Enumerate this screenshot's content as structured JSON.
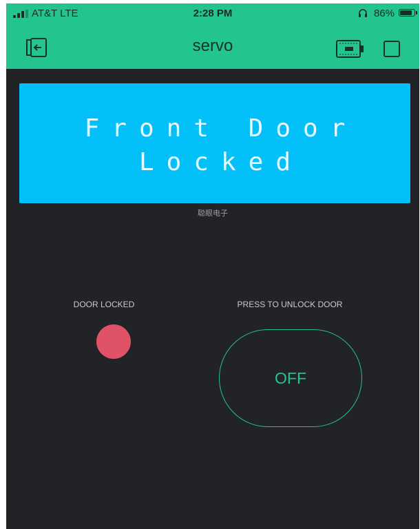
{
  "status_bar": {
    "carrier": "AT&T  LTE",
    "time": "2:28 PM",
    "battery": "86%",
    "battery_level": 0.86
  },
  "nav": {
    "title": "servo",
    "back_icon": "exit-icon",
    "device_icon": "device-icon",
    "stop_icon": "square-icon"
  },
  "lcd": {
    "line1": "Front Door",
    "line2": "Locked",
    "caption": "聪眼电子"
  },
  "led": {
    "label": "DOOR LOCKED",
    "color": "#e05268"
  },
  "button": {
    "label": "PRESS TO UNLOCK DOOR",
    "state": "OFF",
    "color": "#23c48e"
  },
  "colors": {
    "header": "#23c48e",
    "background": "#222327",
    "lcd": "#04c0f8"
  }
}
